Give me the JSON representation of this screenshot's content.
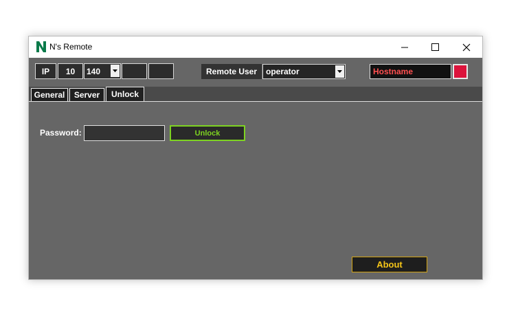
{
  "window": {
    "title": "N's Remote",
    "logo": "N"
  },
  "toolbar": {
    "ip_label": "IP",
    "ip_octets": [
      "10",
      "140",
      "",
      ""
    ],
    "remote_user_label": "Remote User",
    "remote_user_value": "operator",
    "hostname_value": "Hostname",
    "status_color": "#dc143c"
  },
  "tabs": [
    {
      "label": "General"
    },
    {
      "label": "Server"
    },
    {
      "label": "Unlock"
    }
  ],
  "unlock": {
    "password_label": "Password:",
    "password_value": "",
    "unlock_button": "Unlock"
  },
  "about_button": "About",
  "colors": {
    "accent_green": "#7ed321",
    "about_gold": "#f5c518",
    "hostname_red": "#ff5050"
  }
}
